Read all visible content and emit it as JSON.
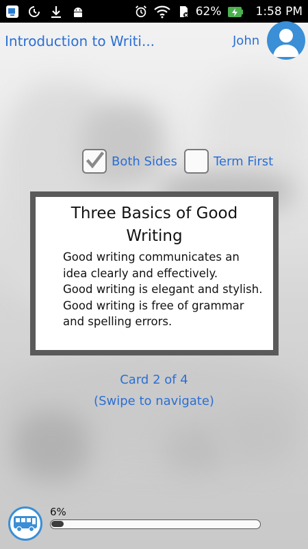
{
  "status_bar": {
    "battery_percent": "62%",
    "time": "1:58 PM",
    "icons": [
      "app-switch-icon",
      "sync-icon",
      "download-icon",
      "android-icon",
      "alarm-icon",
      "wifi-icon",
      "sd-card-icon",
      "battery-charging-icon"
    ]
  },
  "header": {
    "title": "Introduction to Writi...",
    "username": "John"
  },
  "options": {
    "both_sides_label": "Both Sides",
    "both_sides_checked": true,
    "term_first_label": "Term First",
    "term_first_checked": false
  },
  "card": {
    "title": "Three Basics of Good Writing",
    "lines": [
      "Good writing communicates an idea clearly and effectively.",
      "Good writing is elegant and stylish.",
      "Good writing is free of grammar and spelling errors."
    ]
  },
  "navigation": {
    "card_count": "Card 2 of 4",
    "hint": "(Swipe to navigate)"
  },
  "progress": {
    "label": "6%",
    "value": 0.06
  },
  "colors": {
    "accent": "#2a6fd4",
    "avatar_bg": "#3a8fd6",
    "card_border": "#5a5a5a"
  }
}
